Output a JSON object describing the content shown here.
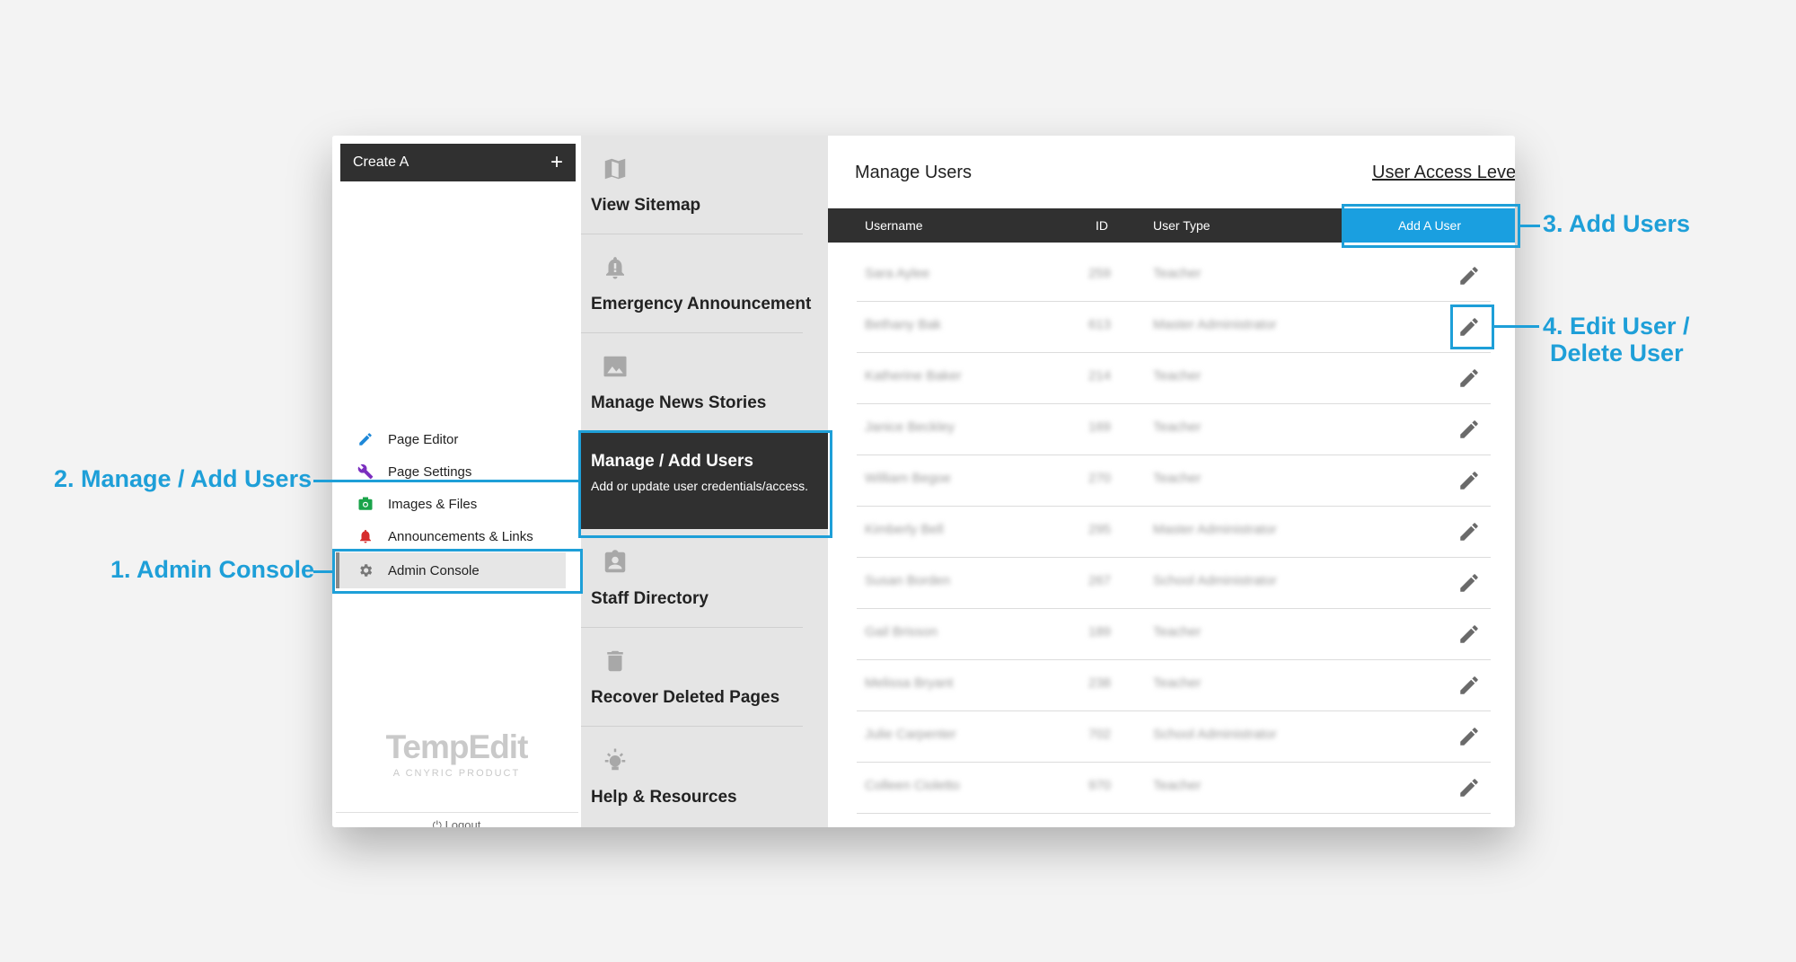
{
  "sidebar": {
    "create_label": "Create A",
    "create_plus": "+",
    "items": [
      {
        "label": "Page Editor",
        "color": "#1e88d8"
      },
      {
        "label": "Page Settings",
        "color": "#7b2fbf"
      },
      {
        "label": "Images & Files",
        "color": "#1aa34a"
      },
      {
        "label": "Announcements & Links",
        "color": "#d62b2b"
      },
      {
        "label": "Admin Console",
        "color": "#777777"
      }
    ],
    "logo": "TempEdit",
    "logo_sub": "A CNYRIC PRODUCT",
    "logout": "Logout"
  },
  "menu": {
    "items": [
      {
        "label": "View Sitemap",
        "icon": "map-icon"
      },
      {
        "label": "Emergency Announcement",
        "icon": "bell-icon"
      },
      {
        "label": "Manage News Stories",
        "icon": "image-icon"
      },
      {
        "label": "Staff Directory",
        "icon": "badge-icon"
      },
      {
        "label": "Recover Deleted Pages",
        "icon": "trash-icon"
      },
      {
        "label": "Help & Resources",
        "icon": "lightbulb-icon"
      }
    ],
    "active": {
      "title": "Manage / Add Users",
      "description": "Add or update user credentials/access."
    }
  },
  "main": {
    "title": "Manage Users",
    "access_link": "User Access Levels",
    "columns": [
      "Username",
      "ID",
      "User Type"
    ],
    "add_button": "Add A User",
    "rows": [
      {
        "username": "Sara Aylee",
        "id": "259",
        "type": "Teacher"
      },
      {
        "username": "Bethany Bak",
        "id": "613",
        "type": "Master Administrator"
      },
      {
        "username": "Katherine Baker",
        "id": "214",
        "type": "Teacher"
      },
      {
        "username": "Janice Beckley",
        "id": "169",
        "type": "Teacher"
      },
      {
        "username": "William Begoe",
        "id": "270",
        "type": "Teacher"
      },
      {
        "username": "Kimberly Bell",
        "id": "295",
        "type": "Master Administrator"
      },
      {
        "username": "Susan Borden",
        "id": "267",
        "type": "School Administrator"
      },
      {
        "username": "Gail Brisson",
        "id": "189",
        "type": "Teacher"
      },
      {
        "username": "Melissa Bryant",
        "id": "238",
        "type": "Teacher"
      },
      {
        "username": "Julie Carpenter",
        "id": "702",
        "type": "School Administrator"
      },
      {
        "username": "Colleen Cioletto",
        "id": "970",
        "type": "Teacher"
      }
    ]
  },
  "annotations": {
    "admin_console": "1. Admin Console",
    "manage_users": "2. Manage / Add Users",
    "add_users": "3. Add Users",
    "edit_user_line1": "4. Edit User /",
    "edit_user_line2": "Delete User",
    "color": "#1e9fd8"
  }
}
